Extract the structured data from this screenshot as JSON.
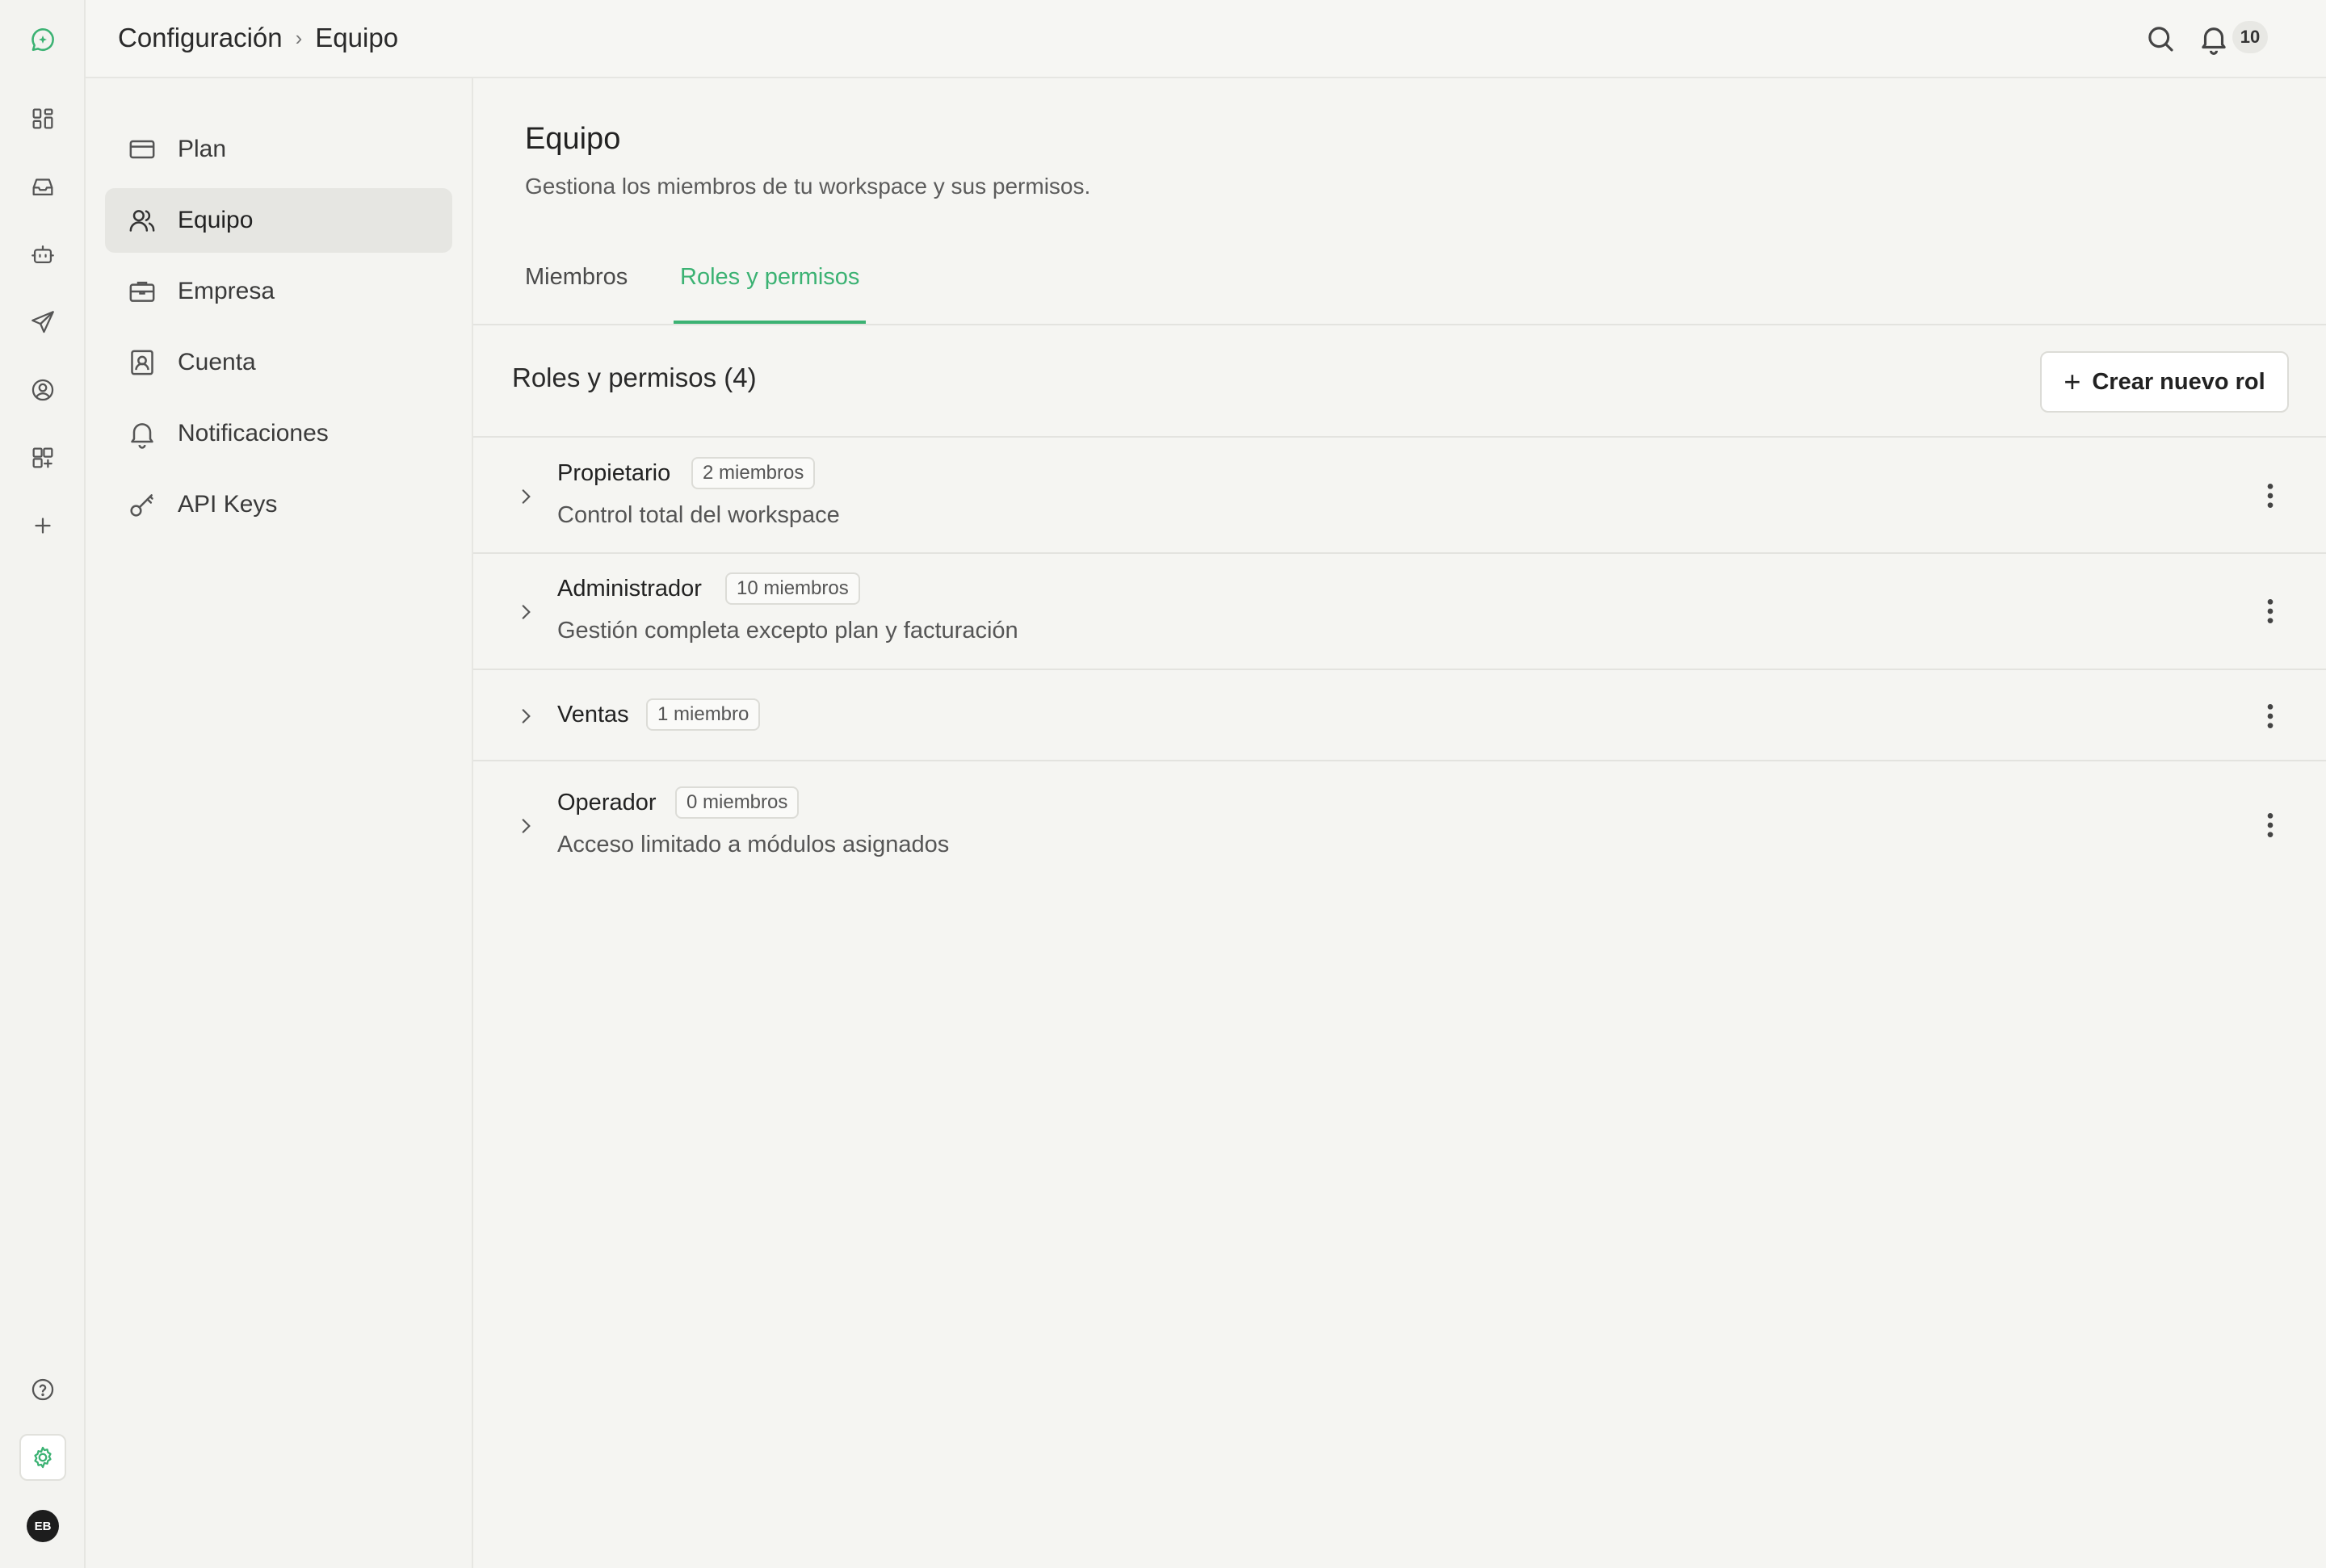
{
  "header": {
    "breadcrumb": [
      "Configuración",
      "Equipo"
    ],
    "notification_count": "10"
  },
  "rail": {
    "avatar_initials": "EB",
    "accent_color": "#3bb273"
  },
  "sidebar": {
    "items": [
      {
        "label": "Plan",
        "icon": "credit-card-icon"
      },
      {
        "label": "Equipo",
        "icon": "users-icon",
        "active": true
      },
      {
        "label": "Empresa",
        "icon": "briefcase-icon"
      },
      {
        "label": "Cuenta",
        "icon": "contact-card-icon"
      },
      {
        "label": "Notificaciones",
        "icon": "bell-icon"
      },
      {
        "label": "API Keys",
        "icon": "key-icon"
      }
    ]
  },
  "main": {
    "title": "Equipo",
    "subtitle": "Gestiona los miembros de tu workspace y sus permisos.",
    "tabs": [
      {
        "label": "Miembros"
      },
      {
        "label": "Roles y permisos",
        "active": true
      }
    ],
    "list_title": "Roles y permisos (4)",
    "create_button": "Crear nuevo rol",
    "roles": [
      {
        "name": "Propietario",
        "members": "2 miembros",
        "description": "Control total del workspace"
      },
      {
        "name": "Administrador",
        "members": "10 miembros",
        "description": "Gestión completa excepto plan y facturación"
      },
      {
        "name": "Ventas",
        "members": "1 miembro",
        "description": ""
      },
      {
        "name": "Operador",
        "members": "0 miembros",
        "description": "Acceso limitado a módulos asignados"
      }
    ]
  }
}
